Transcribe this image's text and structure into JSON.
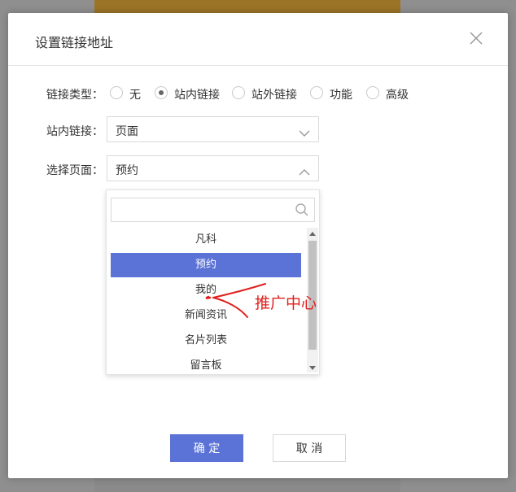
{
  "dialog": {
    "title": "设置链接地址"
  },
  "link_type": {
    "label": "链接类型：",
    "options": [
      {
        "label": "无",
        "selected": false
      },
      {
        "label": "站内链接",
        "selected": true
      },
      {
        "label": "站外链接",
        "selected": false
      },
      {
        "label": "功能",
        "selected": false
      },
      {
        "label": "高级",
        "selected": false
      }
    ]
  },
  "internal_link": {
    "label": "站内链接：",
    "value": "页面"
  },
  "select_page": {
    "label": "选择页面：",
    "value": "预约",
    "search_placeholder": "",
    "items": [
      "凡科",
      "预约",
      "我的",
      "新闻资讯",
      "名片列表",
      "留言板"
    ],
    "selected_index": 1
  },
  "annotation": {
    "text": "推广中心",
    "color": "#e0211e"
  },
  "footer": {
    "confirm_label": "确 定",
    "cancel_label": "取 消"
  },
  "colors": {
    "accent": "#5b73d6"
  }
}
